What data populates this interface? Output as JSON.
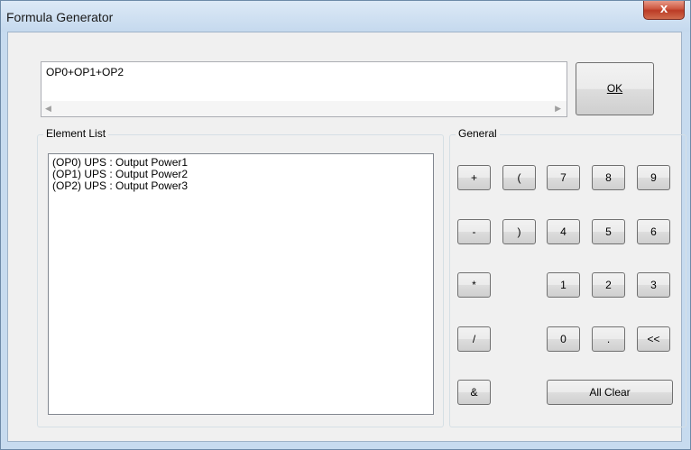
{
  "window": {
    "title": "Formula Generator",
    "close_label": "x"
  },
  "formula": {
    "value": "OP0+OP1+OP2"
  },
  "ok_button": {
    "label": "OK"
  },
  "element_list": {
    "label": "Element List",
    "items": [
      "(OP0) UPS : Output Power1",
      "(OP1) UPS : Output Power2",
      "(OP2) UPS : Output Power3"
    ]
  },
  "general": {
    "label": "General",
    "buttons": {
      "plus": "+",
      "open_paren": "(",
      "seven": "7",
      "eight": "8",
      "nine": "9",
      "minus": "-",
      "close_paren": ")",
      "four": "4",
      "five": "5",
      "six": "6",
      "multiply": "*",
      "one": "1",
      "two": "2",
      "three": "3",
      "divide": "/",
      "zero": "0",
      "dot": ".",
      "backspace": "<<",
      "ampersand": "&",
      "all_clear": "All Clear"
    }
  },
  "icons": {
    "scroll_left": "scroll-left-arrow-icon",
    "scroll_right": "scroll-right-arrow-icon"
  }
}
